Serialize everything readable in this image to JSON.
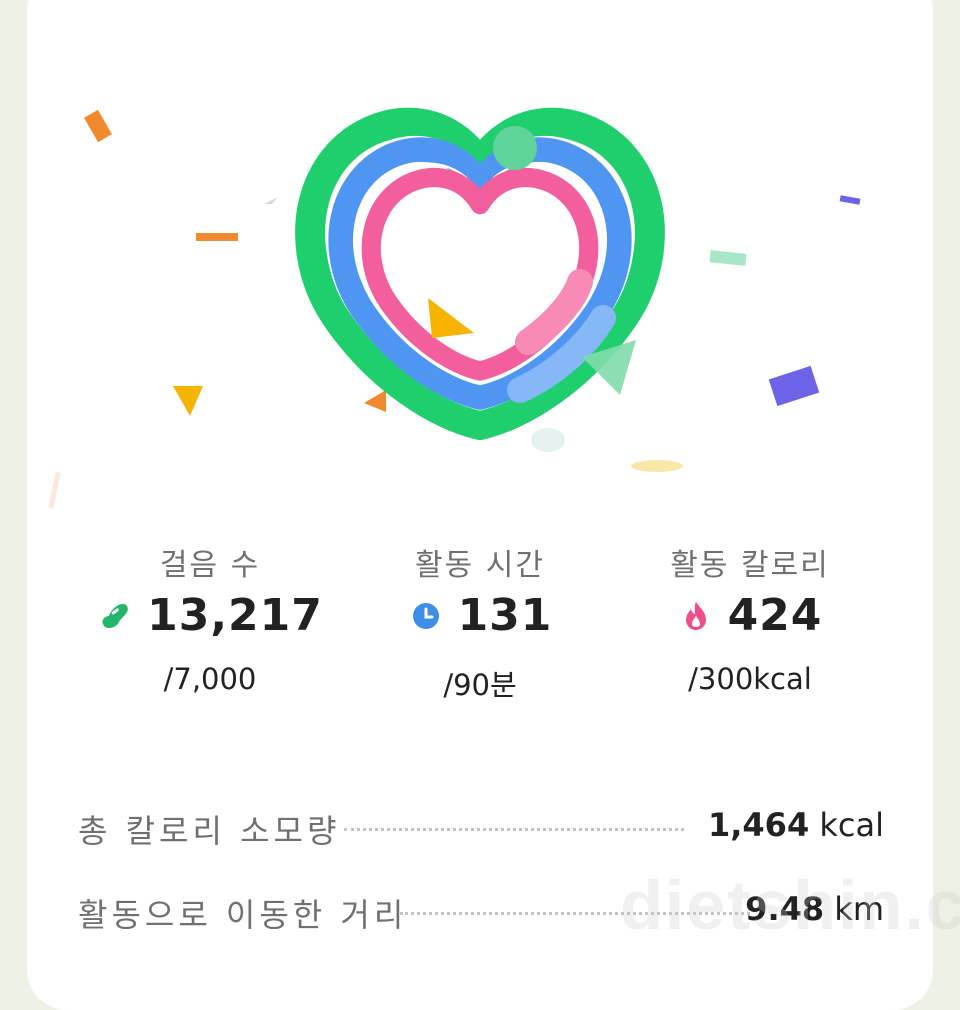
{
  "stats": [
    {
      "label": "걸음 수",
      "value": "13,217",
      "goal": "/7,000",
      "icon": "shoe-icon",
      "color": "#22b768"
    },
    {
      "label": "활동 시간",
      "value": "131",
      "goal": "/90분",
      "icon": "clock-icon",
      "color": "#3d8ee8"
    },
    {
      "label": "활동 칼로리",
      "value": "424",
      "goal": "/300kcal",
      "icon": "flame-icon",
      "color": "#f04d8f"
    }
  ],
  "summary": {
    "calories": {
      "label": "총 칼로리 소모량",
      "number": "1,464",
      "unit": "kcal"
    },
    "distance": {
      "label": "활동으로 이동한 거리",
      "number": "9.48",
      "unit": "km"
    }
  },
  "watermark": "dietshin.com",
  "colors": {
    "outer_ring": "#1fcf6e",
    "middle_ring": "#4f95f2",
    "inner_ring": "#f25f9c"
  }
}
